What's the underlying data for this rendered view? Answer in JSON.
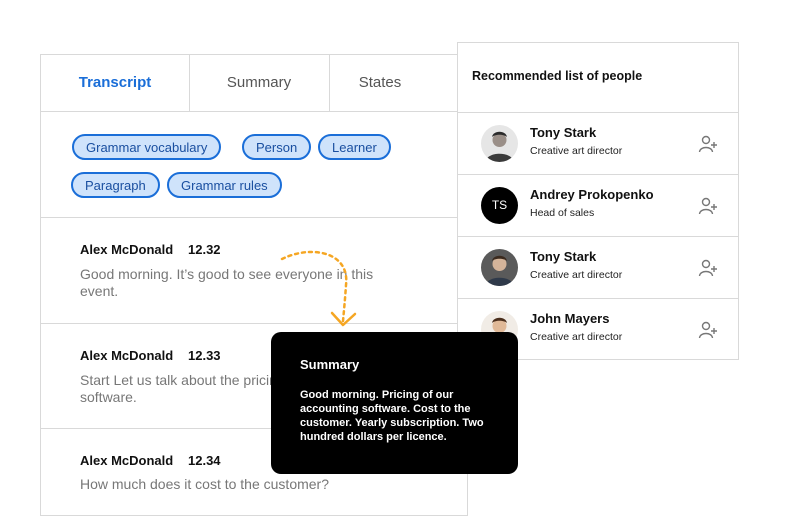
{
  "tabs": [
    {
      "label": "Transcript",
      "active": true
    },
    {
      "label": "Summary",
      "active": false
    },
    {
      "label": "States",
      "active": false
    }
  ],
  "tags": [
    "Grammar vocabulary",
    "Person",
    "Learner",
    "Paragraph",
    "Grammar rules"
  ],
  "entries": [
    {
      "speaker": "Alex McDonald",
      "time": "12.32",
      "text": "Good morning. It’s good to see everyone in this event."
    },
    {
      "speaker": "Alex McDonald",
      "time": "12.33",
      "text": "Start Let us talk about the pricing of our software."
    },
    {
      "speaker": "Alex McDonald",
      "time": "12.34",
      "text": "How much does it cost to the customer?"
    }
  ],
  "people_panel": {
    "title": "Recommended list of people",
    "people": [
      {
        "name": "Tony Stark",
        "role": "Creative art director",
        "avatar": "photo"
      },
      {
        "name": "Andrey Prokopenko",
        "role": "Head of sales",
        "avatar": "initials",
        "initials": "TS"
      },
      {
        "name": "Tony Stark",
        "role": "Creative art director",
        "avatar": "photo"
      },
      {
        "name": "John Mayers",
        "role": "Creative art director",
        "avatar": "photo"
      }
    ]
  },
  "summary_popup": {
    "title": "Summary",
    "text": "Good morning. Pricing of our accounting software. Cost to the customer. Yearly subscription. Two hundred dollars per licence."
  },
  "colors": {
    "accent": "#1a6ed8",
    "chip_bg": "#cfe3fb",
    "arrow": "#f5a623"
  }
}
